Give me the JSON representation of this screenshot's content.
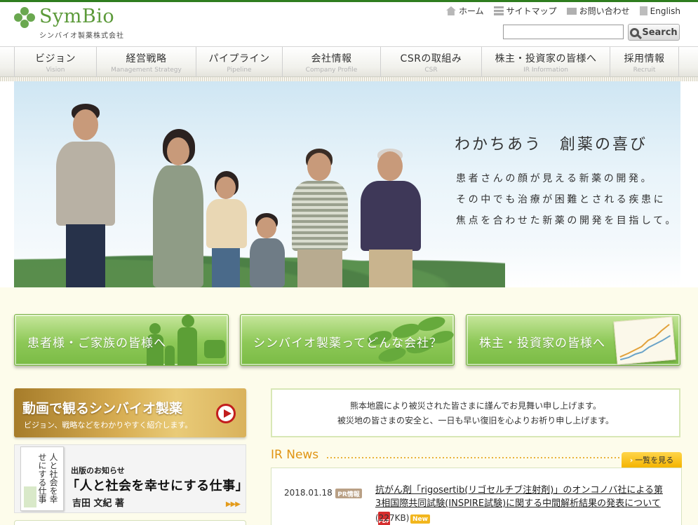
{
  "brand": {
    "logo_text": "SymBio",
    "company_name": "シンバイオ製薬株式会社",
    "colors": {
      "green": "#5c9a3a",
      "accent": "#e09413",
      "nav_text": "#333333"
    }
  },
  "utility_links": [
    {
      "icon": "home-icon",
      "label": "ホーム"
    },
    {
      "icon": "sitemap-icon",
      "label": "サイトマップ"
    },
    {
      "icon": "mail-icon",
      "label": "お問い合わせ"
    },
    {
      "icon": "document-icon",
      "label": "English"
    }
  ],
  "search": {
    "placeholder": "",
    "button_label": "Search"
  },
  "nav": [
    {
      "jp": "ビジョン",
      "en": "Vision"
    },
    {
      "jp": "経営戦略",
      "en": "Management Strategy"
    },
    {
      "jp": "パイプライン",
      "en": "Pipeline"
    },
    {
      "jp": "会社情報",
      "en": "Company Profile"
    },
    {
      "jp": "CSRの取組み",
      "en": "CSR"
    },
    {
      "jp": "株主・投資家の皆様へ",
      "en": "IR Information"
    },
    {
      "jp": "採用情報",
      "en": "Recruit"
    }
  ],
  "hero": {
    "title": "わかちあう　創薬の喜び",
    "lines": [
      "患者さんの顔が見える新薬の開発。",
      "その中でも治療が困難とされる疾患に",
      "焦点を合わせた新薬の開発を目指して。"
    ]
  },
  "feature_buttons": [
    {
      "label": "患者様・ご家族の皆様へ"
    },
    {
      "label": "シンバイオ製薬ってどんな会社？"
    },
    {
      "label": "株主・投資家の皆様へ"
    }
  ],
  "video_banner": {
    "title": "動画で観るシンバイオ製薬",
    "subtitle": "ビジョン、戦略などをわかりやすく紹介します。"
  },
  "book_banner": {
    "cover_title": "人と社会を幸せにする仕事",
    "announcement": "出版のお知らせ",
    "title": "「人と社会を幸せにする仕事」",
    "author": "吉田 文紀 著",
    "arrows": "▶▶▶"
  },
  "notice": {
    "lines": [
      "熊本地震により被災された皆さまに謹んでお見舞い申し上げます。",
      "被災地の皆さまの安全と、一日も早い復旧を心よりお祈り申し上げます。"
    ]
  },
  "ir_news": {
    "title": "IR News",
    "more_label": "一覧を見る",
    "items": [
      {
        "date": "2018.01.18",
        "badge": "PR情報",
        "text": "抗がん剤「rigosertib(リゴセルチブ注射剤)」のオンコノバ社による第3相国際共同試験(INSPIRE試験)に関する中間解析結果の発表について",
        "pdf_label": "PDF",
        "size": "(227KB)",
        "new_label": "New"
      }
    ]
  }
}
